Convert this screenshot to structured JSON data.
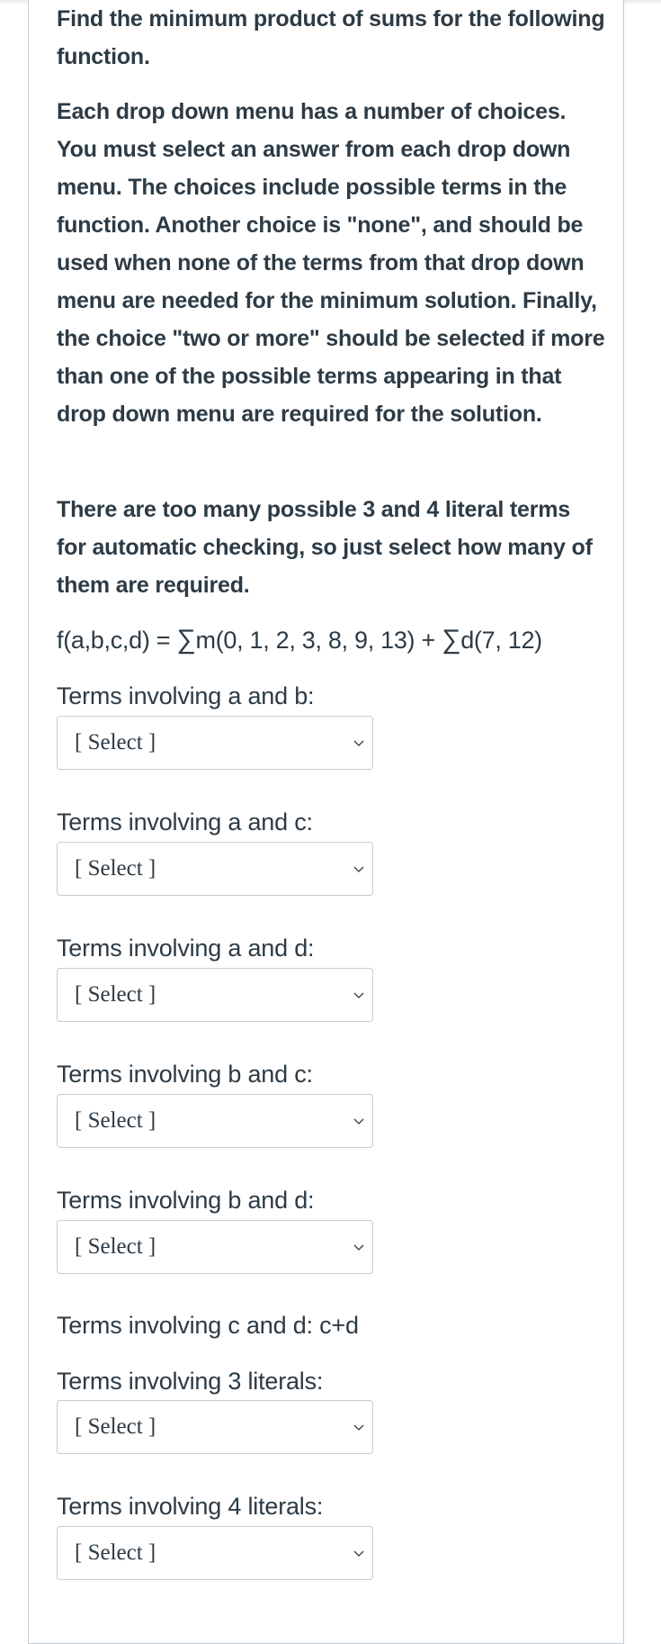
{
  "question": {
    "title": "Find the minimum product of sums for the following function.",
    "instructions": "Each drop down menu has a number of choices. You must select an answer from each drop down menu. The choices include possible terms in the function. Another choice is \"none\", and should be used when none of the terms from that drop down menu are needed for the minimum solution. Finally, the choice \"two or more\" should be selected if more than one of the possible terms appearing in that drop down menu are required for the solution.",
    "note": "There are too many possible 3 and 4 literal terms for automatic checking, so just select how many of them are required.",
    "formula": {
      "lhs": "f(a,b,c,d) = ",
      "sigma": "∑",
      "minterms": "m(0, 1, 2, 3, 8, 9, 13)",
      "plus": " + ",
      "dontcares": "d(7, 12)"
    }
  },
  "fields": [
    {
      "label": "Terms involving a and b:",
      "value": "[ Select ]"
    },
    {
      "label": "Terms involving a and c:",
      "value": "[ Select ]"
    },
    {
      "label": "Terms involving a and d:",
      "value": "[ Select ]"
    },
    {
      "label": "Terms involving b and c:",
      "value": "[ Select ]"
    },
    {
      "label": "Terms involving b and d:",
      "value": "[ Select ]"
    },
    {
      "label": "Terms involving c and d: c+d"
    },
    {
      "label": "Terms involving 3 literals:",
      "value": "[ Select ]"
    },
    {
      "label": "Terms involving 4 literals:",
      "value": "[ Select ]"
    }
  ]
}
